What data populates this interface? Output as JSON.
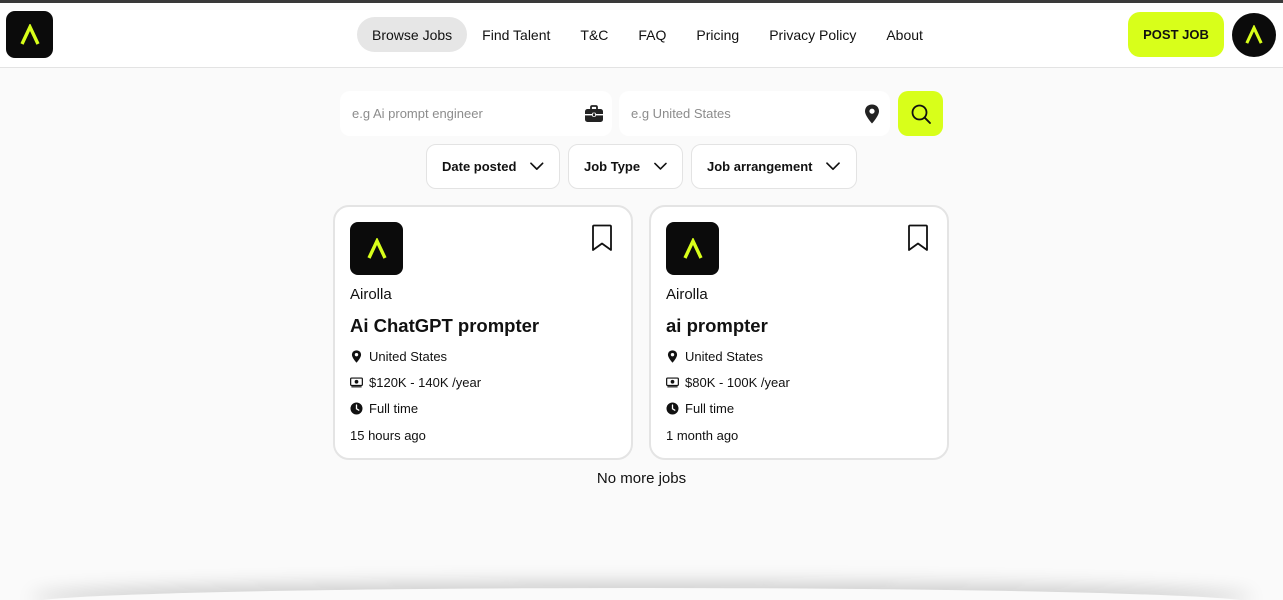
{
  "header": {
    "logo_alt": "Airolla logo",
    "nav": [
      {
        "label": "Browse Jobs",
        "active": true
      },
      {
        "label": "Find Talent",
        "active": false
      },
      {
        "label": "T&C",
        "active": false
      },
      {
        "label": "FAQ",
        "active": false
      },
      {
        "label": "Pricing",
        "active": false
      },
      {
        "label": "Privacy Policy",
        "active": false
      },
      {
        "label": "About",
        "active": false
      }
    ],
    "post_job_label": "POST JOB",
    "accent_color": "#d8ff1a"
  },
  "search": {
    "keyword_placeholder": "e.g Ai prompt engineer",
    "keyword_value": "",
    "keyword_icon": "briefcase-icon",
    "location_placeholder": "e.g United States",
    "location_value": "",
    "location_icon": "location-pin-icon",
    "submit_icon": "search-icon"
  },
  "filters": [
    {
      "label": "Date posted",
      "icon": "chevron-down-icon"
    },
    {
      "label": "Job Type",
      "icon": "chevron-down-icon"
    },
    {
      "label": "Job arrangement",
      "icon": "chevron-down-icon"
    }
  ],
  "jobs": [
    {
      "company": "Airolla",
      "title": "Ai ChatGPT prompter",
      "location": "United States",
      "salary": "$120K - 140K /year",
      "type": "Full time",
      "posted": "15 hours ago"
    },
    {
      "company": "Airolla",
      "title": "ai prompter",
      "location": "United States",
      "salary": "$80K - 100K /year",
      "type": "Full time",
      "posted": "1 month ago"
    }
  ],
  "footer_text": "No more jobs"
}
